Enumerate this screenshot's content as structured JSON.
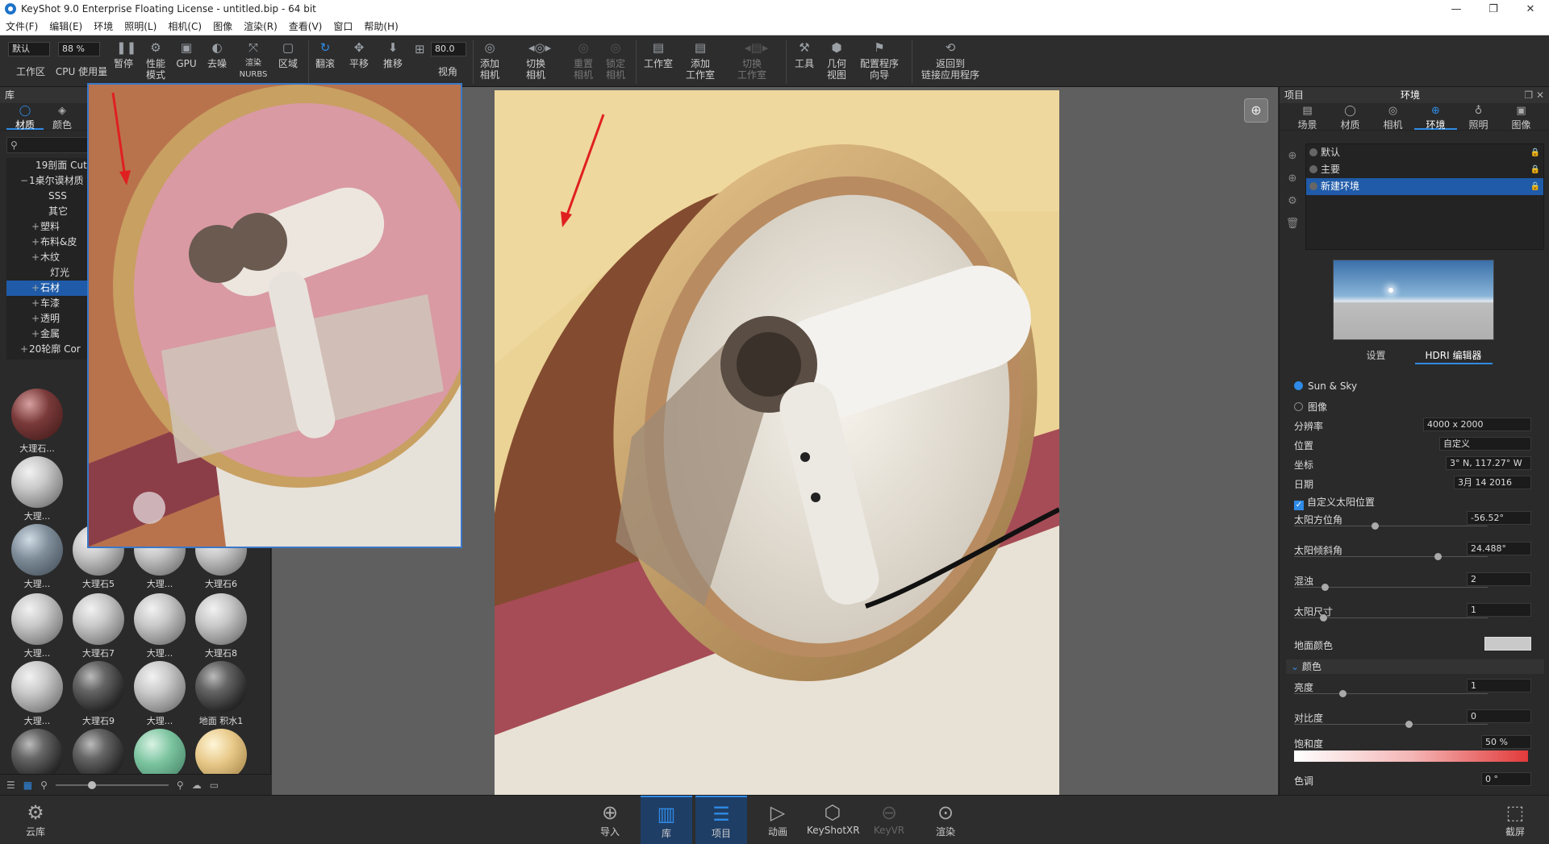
{
  "window": {
    "title": "KeyShot 9.0 Enterprise Floating License  -  untitled.bip  -  64 bit",
    "controls": [
      "—",
      "❐",
      "✕"
    ]
  },
  "menu": [
    "文件(F)",
    "编辑(E)",
    "环境",
    "照明(L)",
    "相机(C)",
    "图像",
    "渲染(R)",
    "查看(V)",
    "窗口",
    "帮助(H)"
  ],
  "toolbar": {
    "workspace_combo": "默认",
    "zoom_combo": "88 %",
    "fov_value": "80.0",
    "items": {
      "workspace": "工作区",
      "cpu_usage": "CPU 使用量",
      "pause": "暂停",
      "perf_mode": "性能\n模式",
      "gpu": "GPU",
      "denoise": "去噪",
      "render_nurbs": "渲染\nNURBS",
      "region": "区域",
      "tumble": "翻滚",
      "pan": "平移",
      "dolly": "推移",
      "fov": "视角",
      "add_camera": "添加\n相机",
      "switch_camera": "切换\n相机",
      "reset_camera": "重置\n相机",
      "lock_camera": "锁定\n相机",
      "studio": "工作室",
      "add_studio": "添加\n工作室",
      "switch_studio": "切换\n工作室",
      "tools": "工具",
      "geometry_view": "几何\n视图",
      "config_wizard": "配置程序\n向导",
      "back_to_app": "返回到\n链接应用程序"
    }
  },
  "library": {
    "title": "库",
    "tabs": [
      "材质",
      "颜色"
    ],
    "search_placeholder": "",
    "tree": [
      {
        "label": "19剖面 Cut",
        "exp": ""
      },
      {
        "label": "1桌尔谟材质",
        "exp": "−"
      },
      {
        "label": "SSS",
        "exp": ""
      },
      {
        "label": "其它",
        "exp": ""
      },
      {
        "label": "塑料",
        "exp": "+"
      },
      {
        "label": "布料&皮",
        "exp": "+"
      },
      {
        "label": "木纹",
        "exp": "+"
      },
      {
        "label": "灯光",
        "exp": ""
      },
      {
        "label": "石材",
        "exp": "+"
      },
      {
        "label": "车漆",
        "exp": "+"
      },
      {
        "label": "透明",
        "exp": "+"
      },
      {
        "label": "金属",
        "exp": "+"
      },
      {
        "label": "20轮廓 Cor",
        "exp": "+"
      }
    ],
    "thumbs": [
      {
        "label": "大理石...",
        "style": "red"
      },
      {
        "label": "大理石5",
        "style": ""
      },
      {
        "label": "大理...",
        "style": ""
      },
      {
        "label": "大理石6",
        "style": ""
      },
      {
        "label": "大理...",
        "style": ""
      },
      {
        "label": "大理石7",
        "style": ""
      },
      {
        "label": "大理...",
        "style": ""
      },
      {
        "label": "大理石8",
        "style": ""
      },
      {
        "label": "大理...",
        "style": ""
      },
      {
        "label": "大理石9",
        "style": "dark"
      },
      {
        "label": "大理...",
        "style": ""
      },
      {
        "label": "地面 积水1",
        "style": "dark"
      }
    ],
    "side_thumbs": [
      {
        "label": "大理...",
        "style": ""
      },
      {
        "label": "大理...",
        "style": "blue"
      }
    ]
  },
  "project": {
    "title": "项目",
    "section": "环境",
    "tabs": [
      "场景",
      "材质",
      "相机",
      "环境",
      "照明",
      "图像"
    ],
    "environments": [
      {
        "label": "默认",
        "lock": "🔒"
      },
      {
        "label": "主要",
        "lock": "🔒"
      },
      {
        "label": "新建环境",
        "lock": "🔒"
      }
    ],
    "subtabs": [
      "设置",
      "HDRI 编辑器"
    ],
    "sun_sky": "Sun & Sky",
    "image": "图像",
    "resolution_label": "分辨率",
    "resolution_value": "4000 x 2000",
    "location_label": "位置",
    "location_value": "自定义",
    "coord_label": "坐标",
    "coord_value": "3°  N, 117.27°  W",
    "date_label": "日期",
    "date_value": "3月 14 2016",
    "custom_sun_label": "自定义太阳位置",
    "sun_azimuth_label": "太阳方位角",
    "sun_azimuth_value": "-56.52°",
    "sun_tilt_label": "太阳倾斜角",
    "sun_tilt_value": "24.488°",
    "turbidity_label": "混浊",
    "turbidity_value": "2",
    "sun_size_label": "太阳尺寸",
    "sun_size_value": "1",
    "ground_color_label": "地面颜色",
    "color_section": "颜色",
    "brightness_label": "亮度",
    "brightness_value": "1",
    "contrast_label": "对比度",
    "contrast_value": "0",
    "saturation_label": "饱和度",
    "saturation_value": "50 %",
    "hue_label": "色调",
    "hue_value": "0 °"
  },
  "bottom": {
    "cloud": "云库",
    "import": "导入",
    "library": "库",
    "project": "项目",
    "animation": "动画",
    "keyshotxr": "KeyShotXR",
    "keyvr": "KeyVR",
    "render": "渲染",
    "screenshot": "截屏"
  },
  "colors": {
    "accent": "#2f8be6",
    "selection": "#1f5ba8",
    "render_bg": "#efd89d",
    "shadow_brown": "#7a3f26",
    "pink_strip": "#a64c56"
  }
}
